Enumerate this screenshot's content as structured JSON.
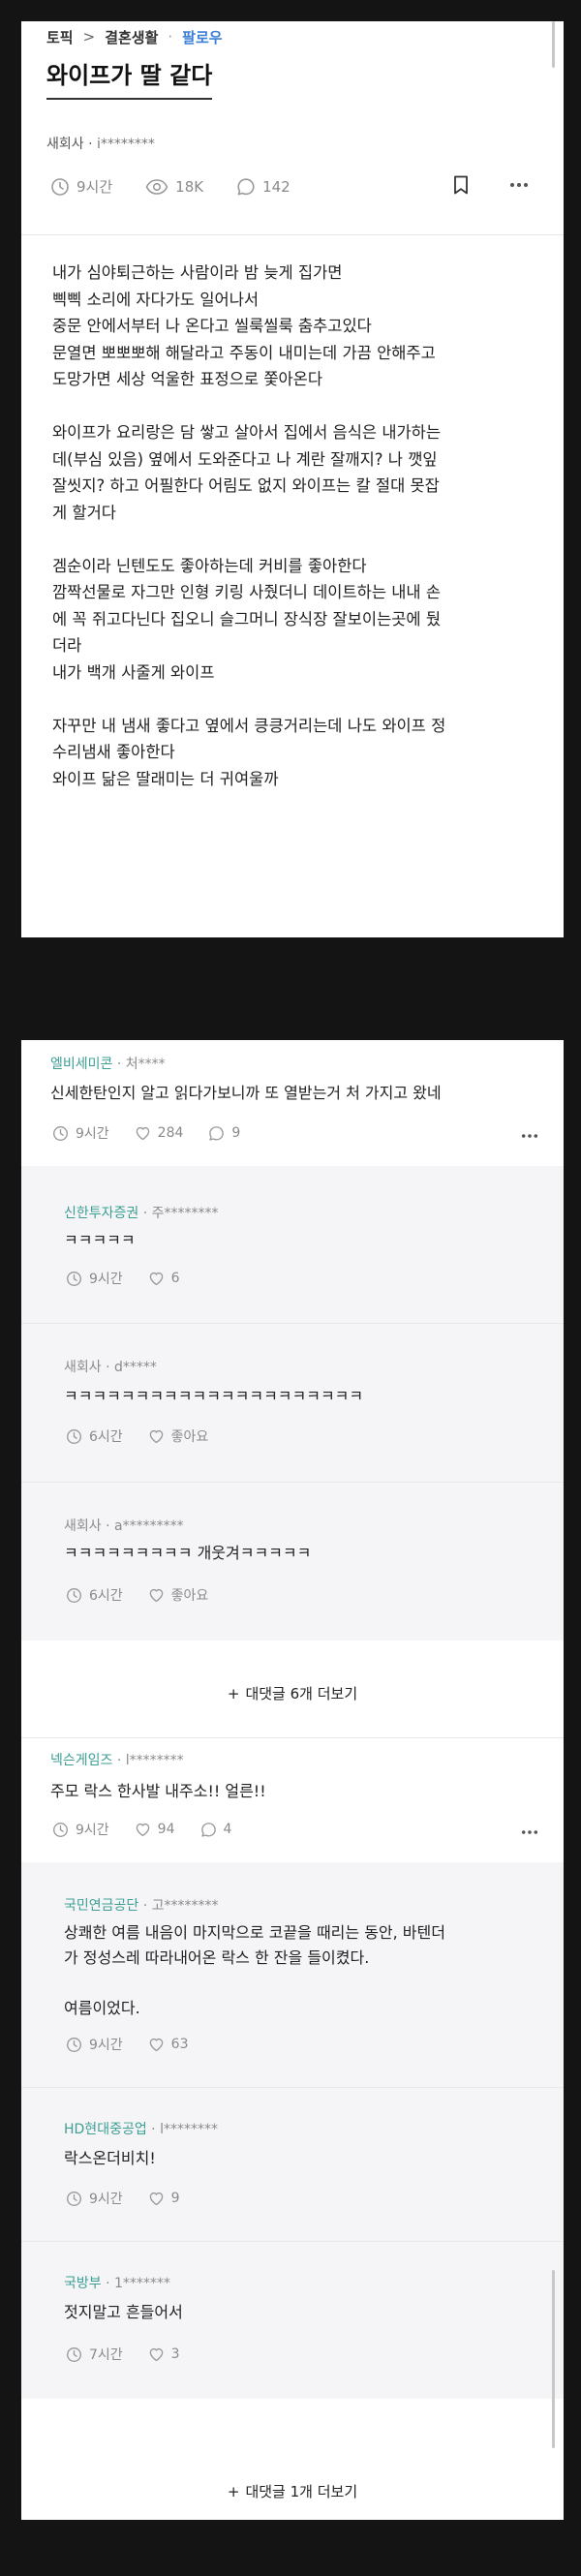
{
  "header": {
    "topic_label": "토픽",
    "separator": ">",
    "category": "결혼생활",
    "dot": "·",
    "follow_label": "팔로우"
  },
  "post": {
    "title": "와이프가 딸 같다",
    "company": "새회사",
    "author_sep": "·",
    "handle": "i********",
    "time": "9시간",
    "views": "18K",
    "comments": "142",
    "paragraphs": [
      [
        "내가 심야퇴근하는 사람이라 밤 늦게 집가면",
        "삑삑 소리에 자다가도 일어나서",
        "중문 안에서부터 나 온다고 씰룩씰룩 춤추고있다",
        "문열면 뽀뽀뽀해 해달라고 주동이 내미는데 가끔 안해주고",
        "도망가면 세상 억울한 표정으로 쫓아온다"
      ],
      [
        "와이프가 요리랑은 담 쌓고 살아서 집에서 음식은 내가하는",
        "데(부심 있음) 옆에서 도와준다고 나 계란 잘깨지? 나 깻잎",
        "잘씻지? 하고 어필한다 어림도 없지 와이프는 칼 절대 못잡",
        "게 할거다"
      ],
      [
        "겜순이라 닌텐도도 좋아하는데 커비를 좋아한다",
        "깜짝선물로 자그만 인형 키링 사줬더니 데이트하는 내내 손",
        "에 꼭 쥐고다닌다 집오니 슬그머니 장식장 잘보이는곳에 뒀",
        "더라",
        "내가 백개 사줄게 와이프"
      ],
      [
        "자꾸만 내 냄새 좋다고 옆에서 킁킁거리는데 나도 와이프 정",
        "수리냄새 좋아한다",
        "와이프 닮은 딸래미는 더 귀여울까"
      ]
    ]
  },
  "comments": [
    {
      "company": "엘비세미콘",
      "sep": "·",
      "handle": "처****",
      "text": [
        "신세한탄인지 알고 읽다가보니까 또 열받는거 처 가지고 왔네"
      ],
      "time": "9시간",
      "likes": "284",
      "replies": "9"
    },
    {
      "company": "신한투자증권",
      "sep": "·",
      "handle": "주********",
      "text": [
        "ㅋㅋㅋㅋㅋ"
      ],
      "time": "9시간",
      "likes": "6"
    },
    {
      "company": "새회사",
      "sep": "·",
      "handle": "d*****",
      "text": [
        "ㅋㅋㅋㅋㅋㅋㅋㅋㅋㅋㅋㅋㅋㅋㅋㅋㅋㅋㅋㅋㅋ"
      ],
      "time": "6시간",
      "likes": "좋아요"
    },
    {
      "company": "새회사",
      "sep": "·",
      "handle": "a*********",
      "text": [
        "ㅋㅋㅋㅋㅋㅋㅋㅋㅋ 개웃겨ㅋㅋㅋㅋㅋ"
      ],
      "time": "6시간",
      "likes": "좋아요"
    },
    {
      "company": "넥슨게임즈",
      "sep": "·",
      "handle": "l********",
      "text": [
        "주모 락스 한사발 내주소!! 얼른!!"
      ],
      "time": "9시간",
      "likes": "94",
      "replies": "4"
    },
    {
      "company": "국민연금공단",
      "sep": "·",
      "handle": "고********",
      "text": [
        "상쾌한 여름 내음이 마지막으로 코끝을 때리는 동안, 바텐더",
        "가 정성스레 따라내어온 락스 한 잔을 들이켰다.",
        "",
        "여름이었다."
      ],
      "time": "9시간",
      "likes": "63"
    },
    {
      "company": "HD현대중공업",
      "sep": "·",
      "handle": "l********",
      "text": [
        "락스온더비치!"
      ],
      "time": "9시간",
      "likes": "9"
    },
    {
      "company": "국방부",
      "sep": "·",
      "handle": "1*******",
      "text": [
        "젓지말고 흔들어서"
      ],
      "time": "7시간",
      "likes": "3"
    }
  ],
  "more_replies": [
    {
      "plus": "+",
      "label": "대댓글 6개 더보기"
    },
    {
      "plus": "+",
      "label": "대댓글 1개 더보기"
    }
  ],
  "icons": {
    "clock": "clock-icon",
    "eye": "eye-icon",
    "comment": "comment-icon",
    "heart": "heart-icon",
    "bookmark": "bookmark-icon",
    "more": "more-icon"
  },
  "colors": {
    "follow": "#3d7fd6",
    "company": "#3c9e94",
    "meta": "#8a8a8a",
    "reply_bg": "#f5f5f7",
    "page_bg": "#141414"
  }
}
